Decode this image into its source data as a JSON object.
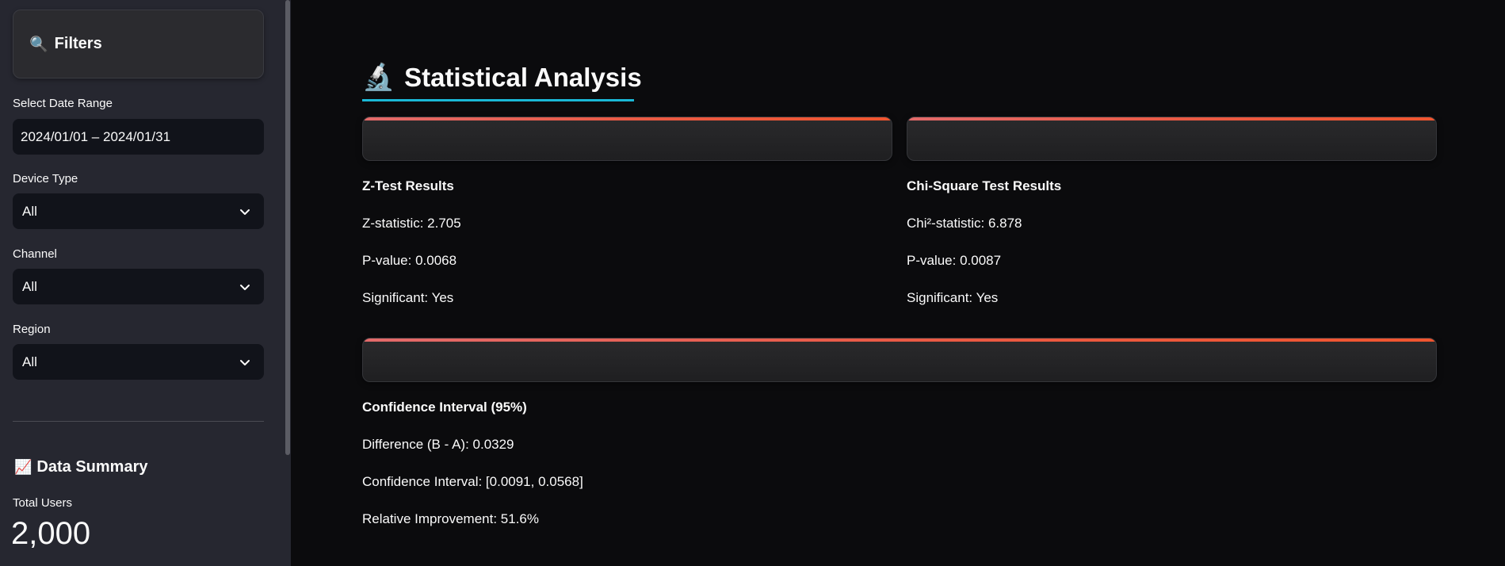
{
  "sidebar": {
    "filters_icon": "🔍",
    "filters_title": "Filters",
    "date_range": {
      "label": "Select Date Range",
      "value": "2024/01/01 – 2024/01/31"
    },
    "device_type": {
      "label": "Device Type",
      "value": "All"
    },
    "channel": {
      "label": "Channel",
      "value": "All"
    },
    "region": {
      "label": "Region",
      "value": "All"
    },
    "summary": {
      "icon": "📈",
      "title": "Data Summary",
      "total_users_label": "Total Users",
      "total_users_value": "2,000"
    }
  },
  "main": {
    "section": {
      "icon": "🔬",
      "title": "Statistical Analysis",
      "accent_color": "#1ab8d6"
    },
    "z_test": {
      "title": "Z-Test Results",
      "statistic": "Z-statistic: 2.705",
      "p_value": "P-value: 0.0068",
      "significant": "Significant: Yes"
    },
    "chi_square": {
      "title": "Chi-Square Test Results",
      "statistic": "Chi²-statistic: 6.878",
      "p_value": "P-value: 0.0087",
      "significant": "Significant: Yes"
    },
    "confidence": {
      "title": "Confidence Interval (95%)",
      "difference": "Difference (B - A): 0.0329",
      "interval": "Confidence Interval: [0.0091, 0.0568]",
      "improvement": "Relative Improvement: 51.6%"
    }
  },
  "colors": {
    "card_accent_start": "#e36a6a",
    "card_accent_end": "#f0552f",
    "sidebar_bg": "#262730",
    "main_bg": "#0b0b0d"
  }
}
